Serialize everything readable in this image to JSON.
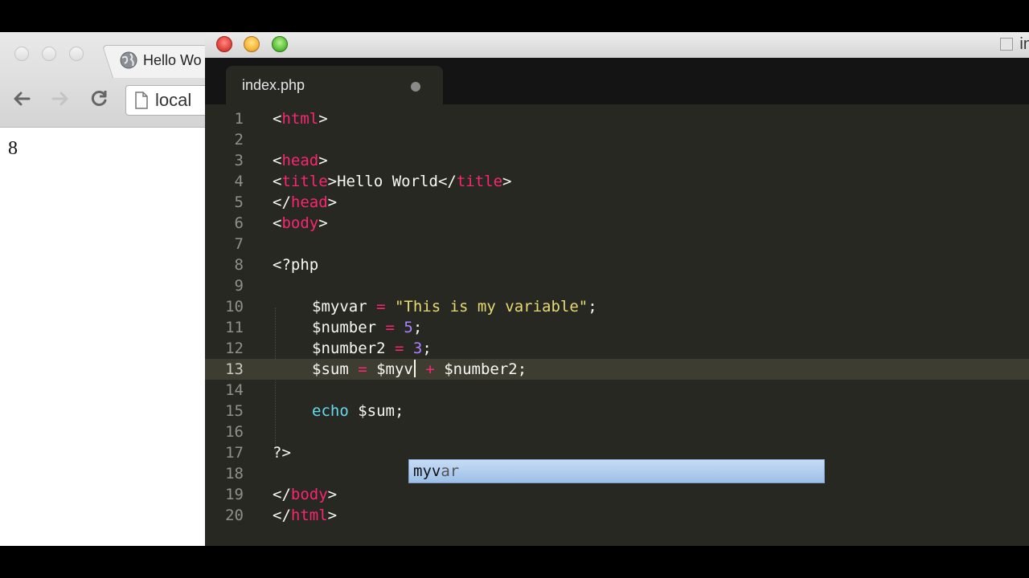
{
  "browser": {
    "tab_title": "Hello Wo",
    "address_text": "local",
    "page_output": "8",
    "icons": {
      "back": "arrow-left",
      "forward": "arrow-right",
      "reload": "reload",
      "page": "document",
      "favicon": "globe"
    }
  },
  "editor": {
    "window_title_partial": "in",
    "tab": {
      "label": "index.php",
      "dirty": true
    },
    "current_line": 13,
    "lines": [
      {
        "no": "1"
      },
      {
        "no": "2"
      },
      {
        "no": "3"
      },
      {
        "no": "4"
      },
      {
        "no": "5"
      },
      {
        "no": "6"
      },
      {
        "no": "7"
      },
      {
        "no": "8"
      },
      {
        "no": "9"
      },
      {
        "no": "10"
      },
      {
        "no": "11"
      },
      {
        "no": "12"
      },
      {
        "no": "13"
      },
      {
        "no": "14"
      },
      {
        "no": "15"
      },
      {
        "no": "16"
      },
      {
        "no": "17"
      },
      {
        "no": "18"
      },
      {
        "no": "19"
      },
      {
        "no": "20"
      }
    ],
    "code": {
      "l1": {
        "lt": "<",
        "tag": "html",
        "gt": ">"
      },
      "l3": {
        "lt": "<",
        "tag": "head",
        "gt": ">"
      },
      "l4": {
        "lt": "<",
        "tag1": "title",
        "gt1": ">",
        "text": "Hello World",
        "lt2": "</",
        "tag2": "title",
        "gt2": ">"
      },
      "l5": {
        "lt": "</",
        "tag": "head",
        "gt": ">"
      },
      "l6": {
        "lt": "<",
        "tag": "body",
        "gt": ">"
      },
      "l8": {
        "text": "<?php"
      },
      "l10": {
        "var": "$myvar ",
        "op": "=",
        "sp": " ",
        "str": "\"This is my variable\"",
        "end": ";"
      },
      "l11": {
        "var": "$number ",
        "op": "=",
        "sp": " ",
        "num": "5",
        "end": ";"
      },
      "l12": {
        "var": "$number2 ",
        "op": "=",
        "sp": " ",
        "num": "3",
        "end": ";"
      },
      "l13": {
        "var": "$sum ",
        "op": "=",
        "sp": " ",
        "typed": "$myv",
        "op2": "+",
        "rest": " $number2;"
      },
      "l15": {
        "kw": "echo",
        "rest": " $sum;"
      },
      "l17": {
        "text": "?>"
      },
      "l19": {
        "lt": "</",
        "tag": "body",
        "gt": ">"
      },
      "l20": {
        "lt": "</",
        "tag": "html",
        "gt": ">"
      }
    },
    "autocomplete": {
      "match": "myv",
      "suffix": "ar"
    }
  },
  "colors": {
    "background": "#272822",
    "tag": "#f92672",
    "string": "#e6db74",
    "number": "#ae81ff",
    "keyword": "#66d9ef",
    "foreground": "#f8f8f2"
  }
}
